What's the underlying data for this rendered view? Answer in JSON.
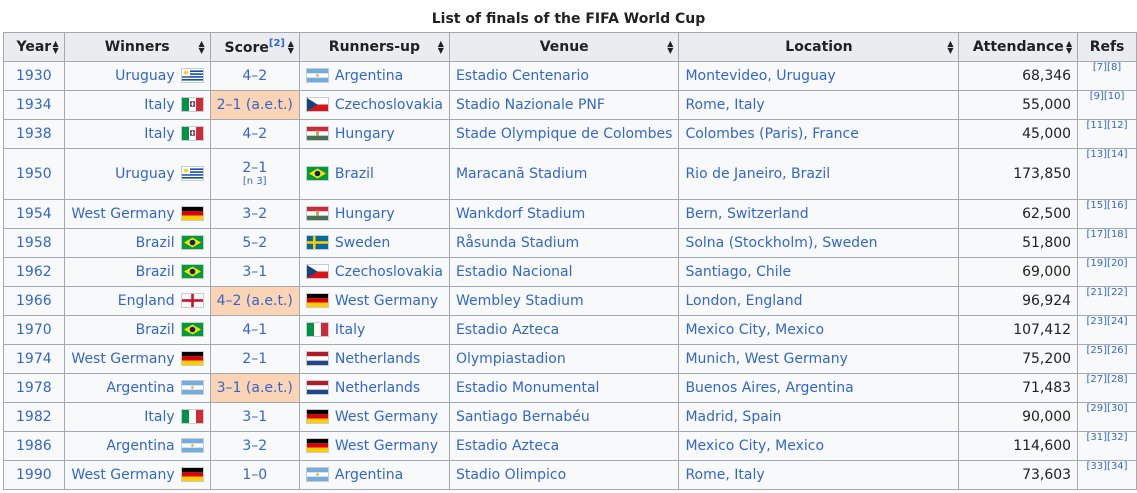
{
  "caption": "List of finals of the FIFA World Cup",
  "headers": {
    "year": "Year",
    "winners": "Winners",
    "score": "Score",
    "score_note": "[2]",
    "runners_up": "Runners-up",
    "venue": "Venue",
    "location": "Location",
    "attendance": "Attendance",
    "refs": "Refs"
  },
  "rows": [
    {
      "year": "1930",
      "winner": "Uruguay",
      "winner_flag": "uruguay-flag",
      "score": "4–2",
      "score_aet": false,
      "score_note": "",
      "runner": "Argentina",
      "runner_flag": "argentina-flag",
      "venue": "Estadio Centenario",
      "location": "Montevideo, Uruguay",
      "attendance": "68,346",
      "refs": "[7][8]"
    },
    {
      "year": "1934",
      "winner": "Italy",
      "winner_flag": "italy-royal-flag",
      "score": "2–1 (a.e.t.)",
      "score_aet": true,
      "score_note": "",
      "runner": "Czechoslovakia",
      "runner_flag": "czechoslovakia-flag",
      "venue": "Stadio Nazionale PNF",
      "location": "Rome, Italy",
      "attendance": "55,000",
      "refs": "[9][10]"
    },
    {
      "year": "1938",
      "winner": "Italy",
      "winner_flag": "italy-royal-flag",
      "score": "4–2",
      "score_aet": false,
      "score_note": "",
      "runner": "Hungary",
      "runner_flag": "hungary-flag",
      "venue": "Stade Olympique de Colombes",
      "location": "Colombes (Paris), France",
      "attendance": "45,000",
      "refs": "[11][12]"
    },
    {
      "year": "1950",
      "winner": "Uruguay",
      "winner_flag": "uruguay-flag",
      "score": "2–1",
      "score_aet": false,
      "score_note": "[n 3]",
      "runner": "Brazil",
      "runner_flag": "brazil-flag",
      "venue": "Maracanã Stadium",
      "location": "Rio de Janeiro, Brazil",
      "attendance": "173,850",
      "refs": "[13][14]"
    },
    {
      "year": "1954",
      "winner": "West Germany",
      "winner_flag": "germany-flag",
      "score": "3–2",
      "score_aet": false,
      "score_note": "",
      "runner": "Hungary",
      "runner_flag": "hungary-flag",
      "venue": "Wankdorf Stadium",
      "location": "Bern, Switzerland",
      "attendance": "62,500",
      "refs": "[15][16]"
    },
    {
      "year": "1958",
      "winner": "Brazil",
      "winner_flag": "brazil-flag",
      "score": "5–2",
      "score_aet": false,
      "score_note": "",
      "runner": "Sweden",
      "runner_flag": "sweden-flag",
      "venue": "Råsunda Stadium",
      "location": "Solna (Stockholm), Sweden",
      "attendance": "51,800",
      "refs": "[17][18]"
    },
    {
      "year": "1962",
      "winner": "Brazil",
      "winner_flag": "brazil-flag",
      "score": "3–1",
      "score_aet": false,
      "score_note": "",
      "runner": "Czechoslovakia",
      "runner_flag": "czechoslovakia-flag",
      "venue": "Estadio Nacional",
      "location": "Santiago, Chile",
      "attendance": "69,000",
      "refs": "[19][20]"
    },
    {
      "year": "1966",
      "winner": "England",
      "winner_flag": "england-flag",
      "score": "4–2 (a.e.t.)",
      "score_aet": true,
      "score_note": "",
      "runner": "West Germany",
      "runner_flag": "germany-flag",
      "venue": "Wembley Stadium",
      "location": "London, England",
      "attendance": "96,924",
      "refs": "[21][22]"
    },
    {
      "year": "1970",
      "winner": "Brazil",
      "winner_flag": "brazil-flag",
      "score": "4–1",
      "score_aet": false,
      "score_note": "",
      "runner": "Italy",
      "runner_flag": "italy-flag",
      "venue": "Estadio Azteca",
      "location": "Mexico City, Mexico",
      "attendance": "107,412",
      "refs": "[23][24]"
    },
    {
      "year": "1974",
      "winner": "West Germany",
      "winner_flag": "germany-flag",
      "score": "2–1",
      "score_aet": false,
      "score_note": "",
      "runner": "Netherlands",
      "runner_flag": "netherlands-flag",
      "venue": "Olympiastadion",
      "location": "Munich, West Germany",
      "attendance": "75,200",
      "refs": "[25][26]"
    },
    {
      "year": "1978",
      "winner": "Argentina",
      "winner_flag": "argentina-flag",
      "score": "3–1 (a.e.t.)",
      "score_aet": true,
      "score_note": "",
      "runner": "Netherlands",
      "runner_flag": "netherlands-flag",
      "venue": "Estadio Monumental",
      "location": "Buenos Aires, Argentina",
      "attendance": "71,483",
      "refs": "[27][28]"
    },
    {
      "year": "1982",
      "winner": "Italy",
      "winner_flag": "italy-flag",
      "score": "3–1",
      "score_aet": false,
      "score_note": "",
      "runner": "West Germany",
      "runner_flag": "germany-flag",
      "venue": "Santiago Bernabéu",
      "location": "Madrid, Spain",
      "attendance": "90,000",
      "refs": "[29][30]"
    },
    {
      "year": "1986",
      "winner": "Argentina",
      "winner_flag": "argentina-flag",
      "score": "3–2",
      "score_aet": false,
      "score_note": "",
      "runner": "West Germany",
      "runner_flag": "germany-flag",
      "venue": "Estadio Azteca",
      "location": "Mexico City, Mexico",
      "attendance": "114,600",
      "refs": "[31][32]"
    },
    {
      "year": "1990",
      "winner": "West Germany",
      "winner_flag": "germany-flag",
      "score": "1–0",
      "score_aet": false,
      "score_note": "",
      "runner": "Argentina",
      "runner_flag": "argentina-flag",
      "venue": "Stadio Olimpico",
      "location": "Rome, Italy",
      "attendance": "73,603",
      "refs": "[33][34]"
    }
  ],
  "colors": {
    "link": "#3366cc",
    "aet_highlight": "#fbd3b5",
    "header_bg": "#eaecf0",
    "cell_bg": "#f8f9fa",
    "border": "#a2a9b1"
  }
}
